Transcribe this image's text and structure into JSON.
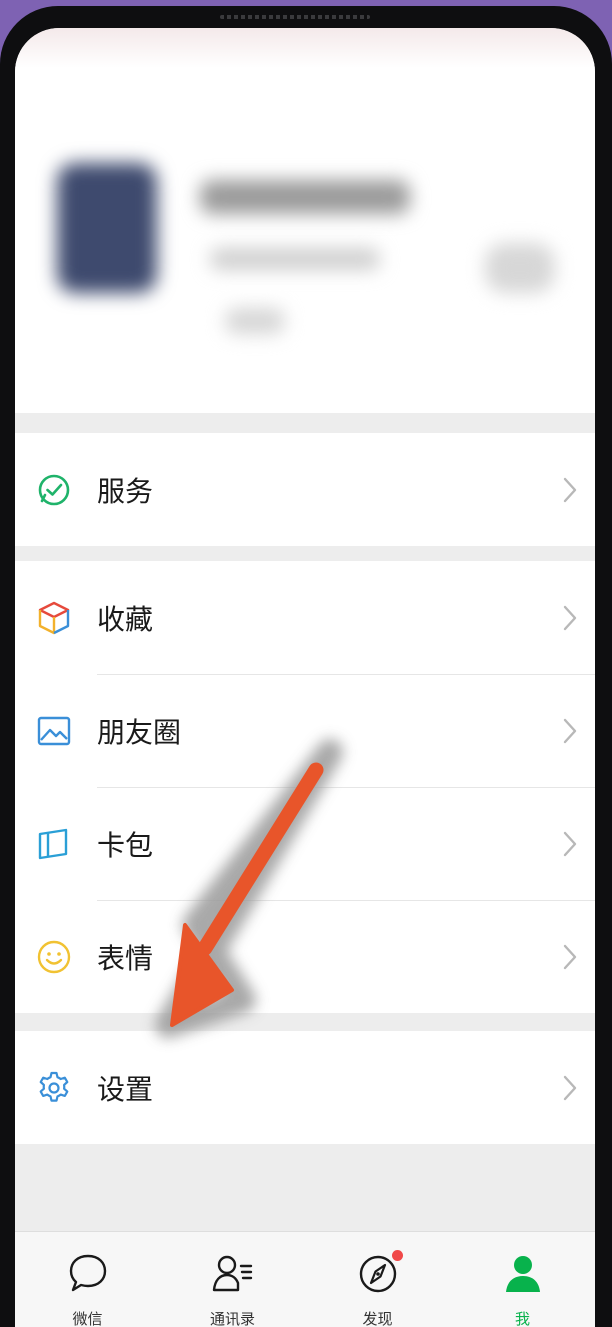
{
  "menu": {
    "services": {
      "label": "服务",
      "icon": "services-check-icon"
    },
    "favorites": {
      "label": "收藏",
      "icon": "favorites-cube-icon"
    },
    "moments": {
      "label": "朋友圈",
      "icon": "moments-image-icon"
    },
    "cards": {
      "label": "卡包",
      "icon": "card-wallet-icon"
    },
    "stickers": {
      "label": "表情",
      "icon": "sticker-smiley-icon"
    },
    "settings": {
      "label": "设置",
      "icon": "settings-gear-icon"
    }
  },
  "tabbar": {
    "chats": {
      "label": "微信",
      "icon": "chat-bubble-icon"
    },
    "contacts": {
      "label": "通讯录",
      "icon": "contacts-icon"
    },
    "discover": {
      "label": "发现",
      "icon": "discover-compass-icon",
      "badge": "red-dot"
    },
    "me": {
      "label": "我",
      "icon": "me-person-icon",
      "active": true
    }
  },
  "colors": {
    "accent": "#08b24c",
    "annotation_arrow": "#e8552a",
    "badge": "#f04848",
    "background": "#7e62b3"
  }
}
